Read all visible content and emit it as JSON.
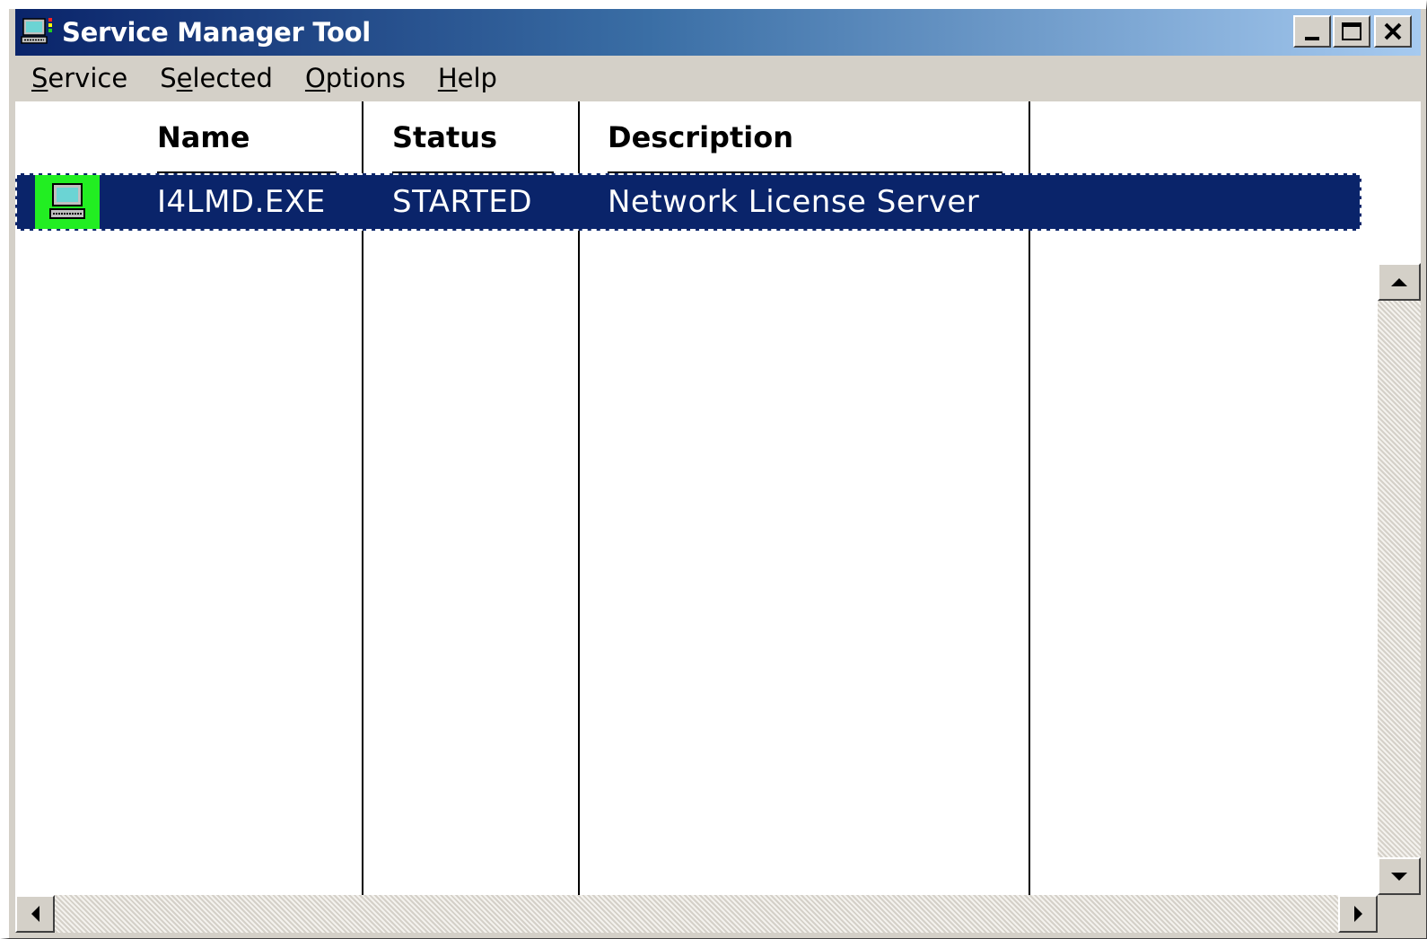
{
  "window": {
    "title": "Service Manager Tool",
    "controls": [
      "minimize",
      "maximize",
      "close"
    ]
  },
  "menu": {
    "items": [
      {
        "prefix": "",
        "accel": "S",
        "rest": "ervice"
      },
      {
        "prefix": "S",
        "accel": "e",
        "rest": "lected"
      },
      {
        "prefix": "",
        "accel": "O",
        "rest": "ptions"
      },
      {
        "prefix": "",
        "accel": "H",
        "rest": "elp"
      }
    ]
  },
  "list": {
    "columns": [
      "Name",
      "Status",
      "Description"
    ],
    "rows": [
      {
        "icon": "computer-icon",
        "name": "I4LMD.EXE",
        "status": "STARTED",
        "description": "Network License Server",
        "selected": true
      }
    ]
  },
  "colors": {
    "title_gradient_start": "#0a246a",
    "title_gradient_end": "#a6caf0",
    "selection": "#0a246a",
    "row_icon_bg": "#22ee22",
    "chrome": "#d4d0c8"
  }
}
